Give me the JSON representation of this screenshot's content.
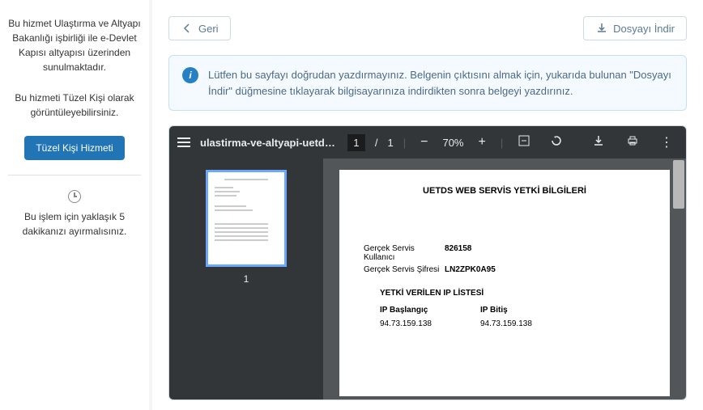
{
  "sidebar": {
    "info1": "Bu hizmet Ulaştırma ve Altyapı Bakanlığı işbirliği ile e-Devlet Kapısı altyapısı üzerinden sunulmaktadır.",
    "info2": "Bu hizmeti Tüzel Kişi olarak görüntüleyebilirsiniz.",
    "button": "Tüzel Kişi Hizmeti",
    "info3": "Bu işlem için yaklaşık 5 dakikanızı ayırmalısınız."
  },
  "topbar": {
    "back": "Geri",
    "download": "Dosyayı İndir"
  },
  "banner": {
    "text": "Lütfen bu sayfayı doğrudan yazdırmayınız. Belgenin çıktısını almak için, yukarıda bulunan \"Dosyayı İndir\" düğmesine tıklayarak bilgisayarınıza indirdikten sonra belgeyi yazdırınız."
  },
  "pdf": {
    "filename": "ulastirma-ve-altyapi-uetds-ip-ta...",
    "page_current": "1",
    "page_total": "1",
    "zoom": "70%",
    "thumb_num": "1"
  },
  "doc": {
    "title": "UETDS WEB SERVİS YETKİ BİLGİLERİ",
    "row1_label": "Gerçek Servis Kullanıcı",
    "row1_value": "826158",
    "row2_label": "Gerçek Servis Şifresi",
    "row2_value": "LN2ZPK0A95",
    "section": "YETKİ VERİLEN IP LİSTESİ",
    "col1_h": "IP Başlangıç",
    "col1_v": "94.73.159.138",
    "col2_h": "IP Bitiş",
    "col2_v": "94.73.159.138"
  }
}
